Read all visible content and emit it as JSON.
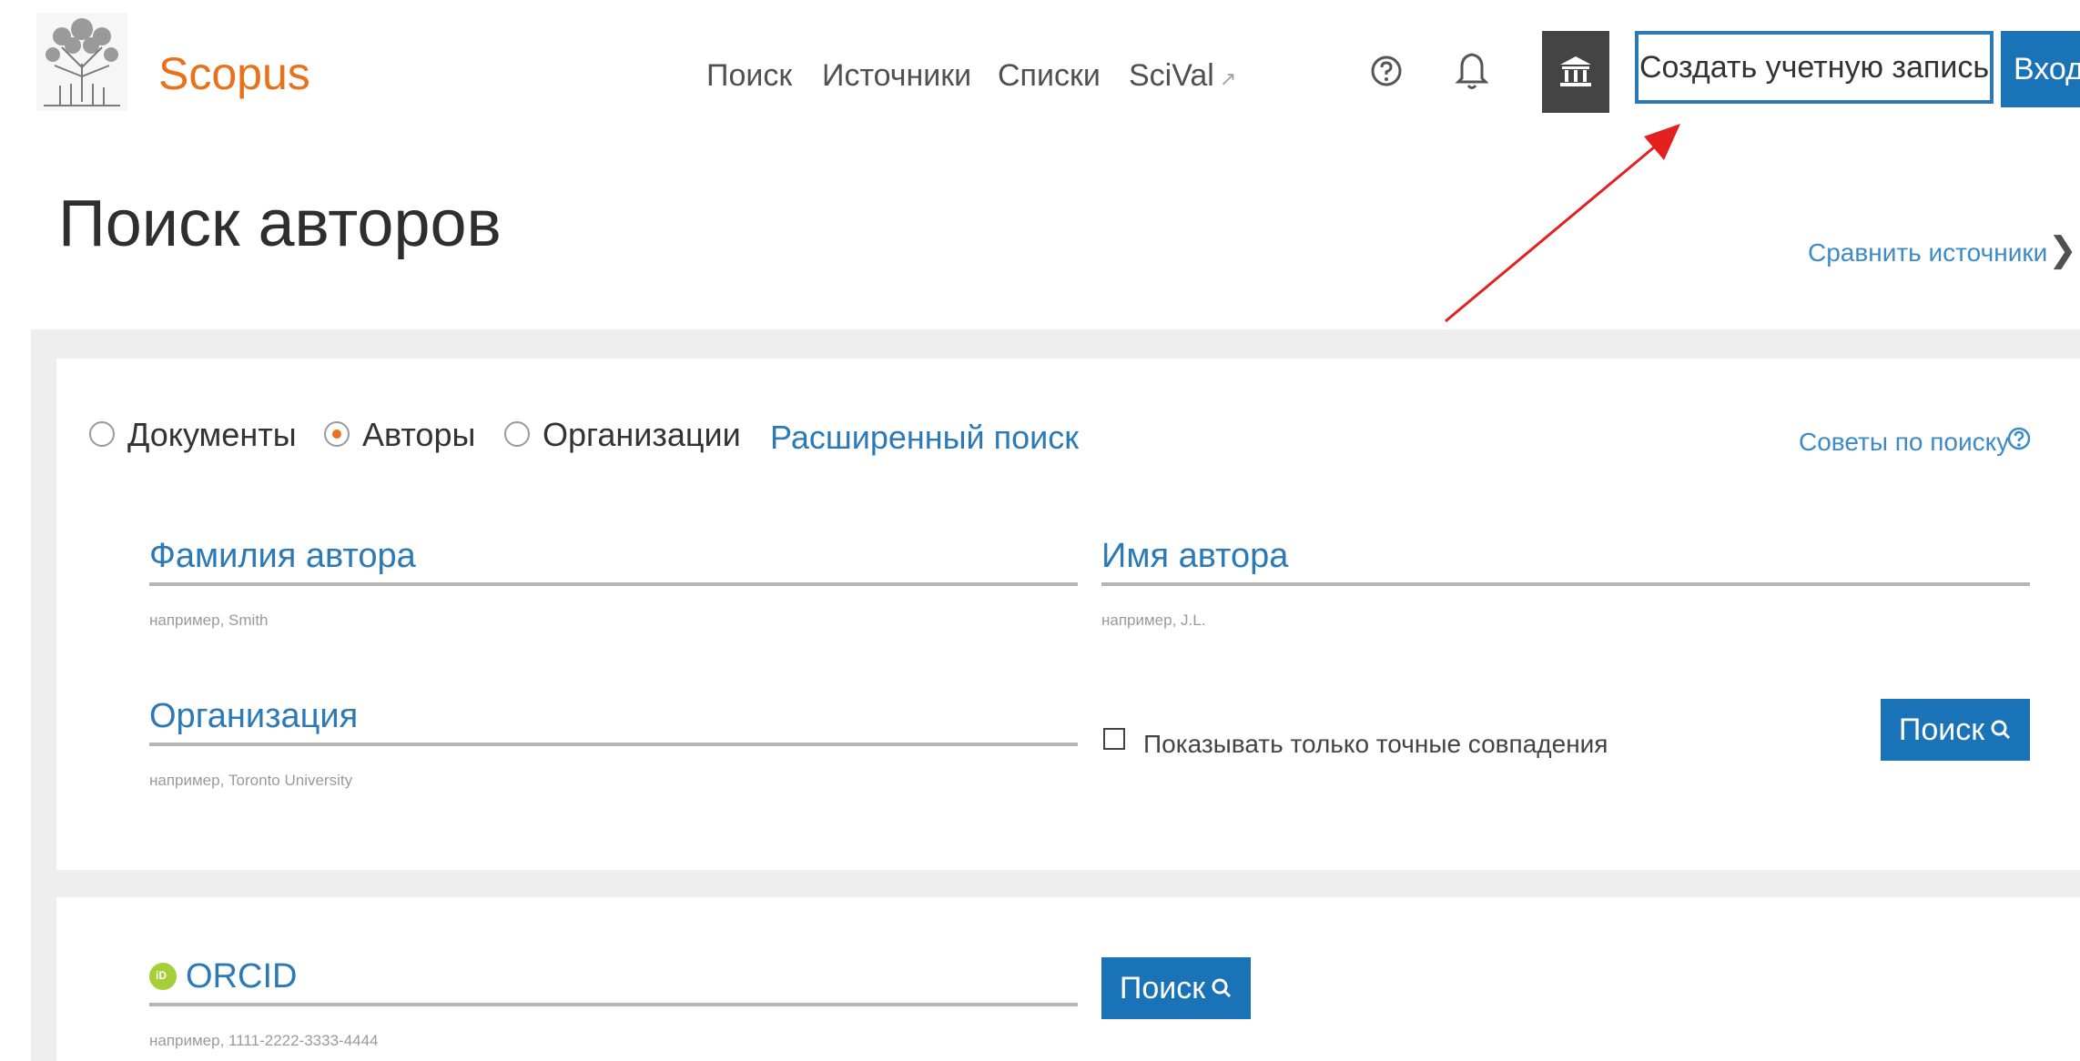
{
  "header": {
    "brand": "Scopus",
    "nav": [
      {
        "label": "Поиск"
      },
      {
        "label": "Источники"
      },
      {
        "label": "Списки"
      },
      {
        "label": "SciVal"
      }
    ],
    "nav_external_glyph": "↗",
    "icons": [
      "help-icon",
      "bell-icon",
      "institution-icon"
    ],
    "signup_label": "Создать учетную запись",
    "signin_label": "Вход"
  },
  "page": {
    "title": "Поиск авторов",
    "compare_label": "Сравнить источники",
    "compare_chevron": "❯"
  },
  "search": {
    "options": [
      {
        "label": "Документы",
        "checked": false
      },
      {
        "label": "Авторы",
        "checked": true
      },
      {
        "label": "Организации",
        "checked": false
      }
    ],
    "advanced_label": "Расширенный поиск",
    "tips_label": "Советы по поиску",
    "fields": {
      "last_name": {
        "label": "Фамилия автора",
        "hint": "например, Smith"
      },
      "first_name": {
        "label": "Имя автора",
        "hint": "например, J.L."
      },
      "affiliation": {
        "label": "Организация",
        "hint": "например, Toronto University"
      }
    },
    "exact_match_label": "Показывать только точные совпадения",
    "search_button": "Поиск"
  },
  "orcid": {
    "label": "ORCID",
    "hint": "например, 1111-2222-3333-4444",
    "search_button": "Поиск"
  },
  "colors": {
    "brand_orange": "#e9711c",
    "primary_blue": "#1a73b7",
    "link_blue": "#2b79b7",
    "annotation_red": "#e32020",
    "panel_gray": "#eeeeee"
  }
}
